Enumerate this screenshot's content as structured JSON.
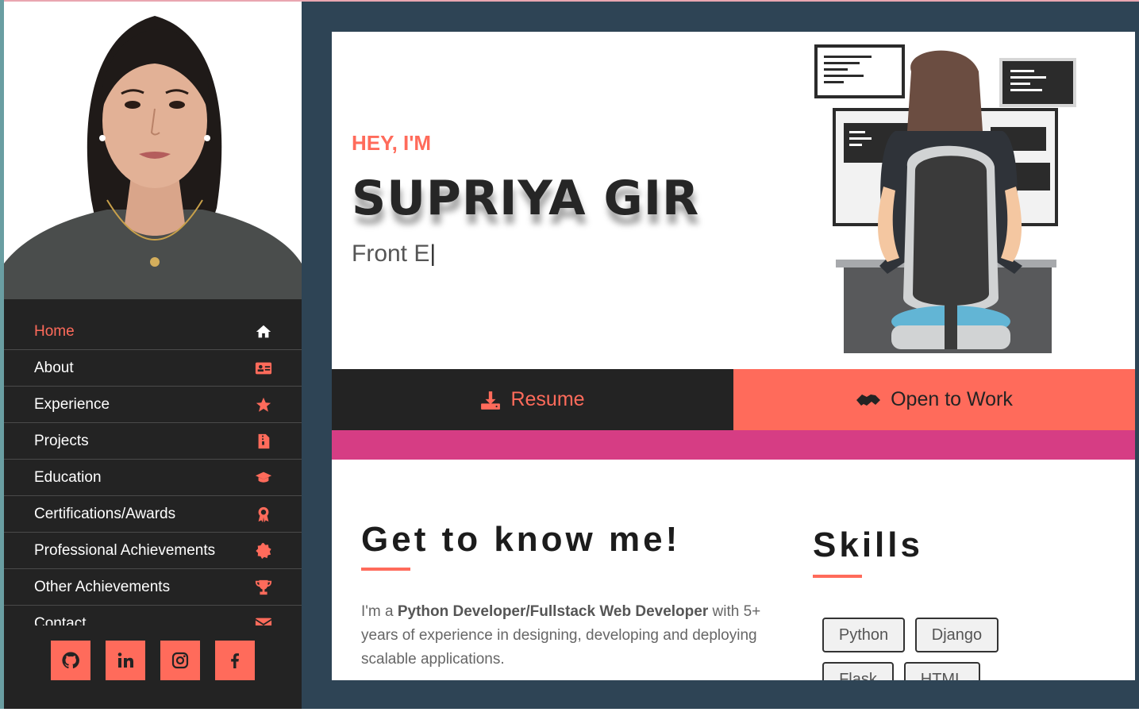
{
  "nav": {
    "items": [
      {
        "label": "Home",
        "icon": "home-icon"
      },
      {
        "label": "About",
        "icon": "id-card-icon"
      },
      {
        "label": "Experience",
        "icon": "star-icon"
      },
      {
        "label": "Projects",
        "icon": "file-icon"
      },
      {
        "label": "Education",
        "icon": "graduation-cap-icon"
      },
      {
        "label": "Certifications/Awards",
        "icon": "award-icon"
      },
      {
        "label": "Professional Achievements",
        "icon": "badge-icon"
      },
      {
        "label": "Other Achievements",
        "icon": "trophy-icon"
      },
      {
        "label": "Contact",
        "icon": "envelope-icon"
      }
    ],
    "active": "Home"
  },
  "socials": [
    "github-icon",
    "linkedin-icon",
    "instagram-icon",
    "facebook-icon"
  ],
  "hero": {
    "greeting": "HEY, I'M",
    "name": "SUPRIYA GIR",
    "role_typed": "Front E",
    "cursor": "|"
  },
  "buttons": {
    "resume": "Resume",
    "open_to_work": "Open to Work"
  },
  "about": {
    "title": "Get to know me!",
    "text_prefix": "I'm a ",
    "text_bold": "Python Developer/Fullstack Web Developer",
    "text_suffix": " with 5+ years of experience in designing, developing and deploying scalable applications."
  },
  "skills": {
    "title": "Skills",
    "items": [
      "Python",
      "Django",
      "Flask",
      "HTML"
    ]
  },
  "colors": {
    "accent": "#ff6b5b",
    "sidebar": "#232323",
    "background": "#2e4455",
    "pink_bar": "#d63d84"
  }
}
